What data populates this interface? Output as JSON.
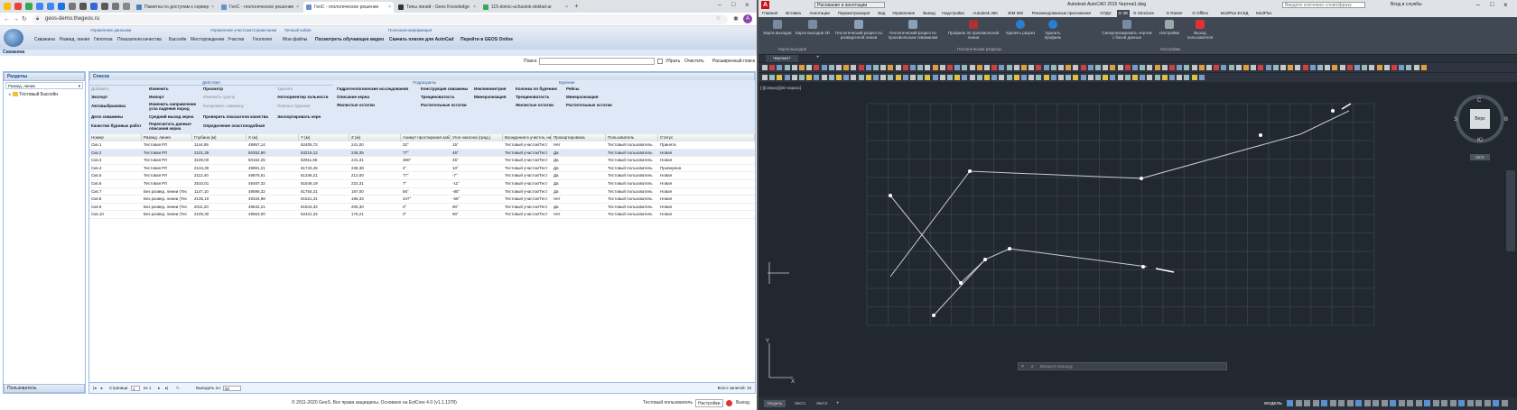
{
  "browser": {
    "tabs": [
      {
        "label": "Памятка по доступам к сервер"
      },
      {
        "label": "ГеоС - геологическое решение"
      },
      {
        "label": "ГеоС - геологическое решение"
      },
      {
        "label": "Типы линий - Geos Knowledge"
      },
      {
        "label": "115-doinic-uchastok-doklad-ar"
      }
    ],
    "url": "geos-demo.thegeos.ru"
  },
  "app": {
    "groups": [
      {
        "label": "Управление данными"
      },
      {
        "label": "Управление участком"
      },
      {
        "label": "Справочники"
      },
      {
        "label": "Личный кабин"
      },
      {
        "label": "Полезная информация"
      }
    ],
    "menu": [
      {
        "label": "Скважина"
      },
      {
        "label": "Развед. линия"
      },
      {
        "label": "Гипотеза"
      },
      {
        "label": "Показатели качества"
      },
      {
        "label": "Бассейн"
      },
      {
        "label": "Месторождение"
      },
      {
        "label": "Участки"
      },
      {
        "label": "Геология"
      },
      {
        "label": "Мои файлы"
      },
      {
        "label": "Посмотреть обучающее видео"
      },
      {
        "label": "Скачать плагин для AutoCad"
      },
      {
        "label": "Перейти в GEOS Online"
      }
    ],
    "section_title": "Скважина",
    "search": {
      "label": "Поиск:",
      "clear": "Убрать",
      "reset": "Очистить",
      "advanced": "Расширенный поиск"
    }
  },
  "sidebar": {
    "title": "Разделы",
    "filter": "Развед. линии",
    "tree_item": "Тестовый Бассейн",
    "bottom": "Пользователь"
  },
  "main": {
    "title": "Список",
    "action_groups": {
      "actions": "Действия",
      "subsections": "Подразделы",
      "drilling": "Бурение"
    },
    "actions": {
      "add": "Добавить",
      "edit": "Изменить",
      "view": "Просмотр",
      "delete": "Удалить",
      "export": "Экспорт",
      "import": "Импорт",
      "change_group": "Изменить группу",
      "autopoint": "Автоориентир зольности",
      "autocalc": "Автовыбраковка",
      "change_dir": "Изменить направление угла падения пород",
      "copy": "Копировать скважину",
      "transfer": "Перенос бурения",
      "drill_depth": "Дело скважины",
      "avg_out": "Средний выход керна",
      "check": "Проверить показатели качества",
      "export_core": "Экспортировать керн",
      "quality": "Качество буровых работ",
      "recalc": "Пересчитать данные описания керна",
      "define": "Определение эластоподобная"
    },
    "subsections": {
      "a": "Гидрогеологические исследования",
      "b": "Конструкция скважины",
      "c": "Инклинометрия",
      "d": "Описание керна",
      "e": "Трещиноватость",
      "f": "Минерализация",
      "g": "Жилистые остатки",
      "h": "Растительные остатки"
    },
    "drilling": {
      "a": "Колонка по бурению",
      "b": "Рейсы",
      "c": "Трещиноватость",
      "d": "Минерализация",
      "e": "Жилистые остатки",
      "f": "Растительные остатки"
    },
    "columns": [
      "Номер",
      "Развед. линия",
      "Глубина (м)",
      "X (м)",
      "Y (м)",
      "Z (м)",
      "Азимут простирания забоя",
      "Угол наклона (град.)",
      "Вхождения в участок, нас",
      "Прокартирована",
      "Пользователь",
      "Статус"
    ],
    "rows": [
      [
        "Скв.1",
        "Тестовая РЛ",
        "1144,95",
        "49957,14",
        "62405,72",
        "241,00",
        "32°",
        "15°",
        "Тестовый участок/Тест",
        "Нет",
        "Тестовый пользователь",
        "Принята"
      ],
      [
        "Скв.2",
        "Тестовая РЛ",
        "2101,35",
        "50262,90",
        "63216,12",
        "245,35",
        "77°",
        "45°",
        "Тестовый участок/Тест",
        "Да",
        "Тестовый пользователь",
        "Новая"
      ],
      [
        "Скв.3",
        "Тестовая РЛ",
        "3100,00",
        "50152,25",
        "62911,65",
        "241,31",
        "360°",
        "45°",
        "Тестовый участок/Тест",
        "Да",
        "Тестовый пользователь",
        "Новая"
      ],
      [
        "Скв.4",
        "Тестовая РЛ",
        "2134,30",
        "49991,21",
        "61743,45",
        "236,38",
        "2°",
        "10°",
        "Тестовый участок/Тест",
        "Да",
        "Тестовый пользователь",
        "Проверена"
      ],
      [
        "Скв.5",
        "Тестовая РЛ",
        "2112,40",
        "49876,51",
        "61346,21",
        "212,00",
        "77°",
        "-7°",
        "Тестовый участок/Тест",
        "Да",
        "Тестовый пользователь",
        "Новая"
      ],
      [
        "Скв.6",
        "Тестовая РЛ",
        "2510,01",
        "49487,32",
        "61646,19",
        "222,31",
        "7°",
        "-11°",
        "Тестовый участок/Тест",
        "Да",
        "Тестовый пользователь",
        "Новая"
      ],
      [
        "Скв.7",
        "Без развед. линии (Тес",
        "1147,10",
        "49596,32",
        "61754,21",
        "187,00",
        "56°",
        "-85°",
        "Тестовый участок/Тест",
        "Да",
        "Тестовый пользователь",
        "Новая"
      ],
      [
        "Скв.8",
        "Без развед. линии (Тес",
        "2135,10",
        "49334,98",
        "61521,31",
        "186,33",
        "247°",
        "-56°",
        "Тестовый участок/Тест",
        "Нет",
        "Тестовый пользователь",
        "Новая"
      ],
      [
        "Скв.9",
        "Без развед. линии (Тес",
        "2011,20",
        "49632,21",
        "61843,32",
        "205,30",
        "0°",
        "90°",
        "Тестовый участок/Тест",
        "Да",
        "Тестовый пользователь",
        "Новая"
      ],
      [
        "Скв.10",
        "Без развед. линии (Тес",
        "2105,30",
        "49563,00",
        "62421,32",
        "175,21",
        "0°",
        "90°",
        "Тестовый участок/Тест",
        "Нет",
        "Тестовый пользователь",
        "Новая"
      ]
    ],
    "pager": {
      "page_label": "Страница",
      "page": "1",
      "of": "из 1",
      "per_page_label": "Выводить по:",
      "per_page": "50",
      "total": "Всего записей: 10"
    }
  },
  "footer": {
    "copyright": "© 2011-2020 GeoS. Все права защищены. Основано на ExtCore 4.0 (v1.1.1378)",
    "user": "Тестовый пользователь",
    "settings": "Настройки",
    "logout": "Выход"
  },
  "acad": {
    "title": "Autodesk AutoCAD 2015   Чертеж1.dwg",
    "workspace": "Рисование и аннотации",
    "search_placeholder": "Введите ключевое слово/фразу",
    "login": "Вход в службы",
    "ribbon_tabs": [
      "Главная",
      "Вставка",
      "Аннотации",
      "Параметризация",
      "Вид",
      "Управление",
      "Вывод",
      "Надстройки",
      "Autodesk 360",
      "BIM 360",
      "Рекомендованные приложения",
      "СПДС",
      "G 3D",
      "G Structure",
      "G Raster",
      "G Offline",
      "ModPlus ЕСКД",
      "ModPlus"
    ],
    "ribbon_buttons": [
      {
        "label": "Карта выходов"
      },
      {
        "label": "Карта выходов 3D"
      },
      {
        "label": "Геологический разрез по разведочной линии"
      },
      {
        "label": "Геологический разрез по произвольным скважинам"
      },
      {
        "label": "Профиль по произвольной линии"
      },
      {
        "label": "Удалить разрез"
      },
      {
        "label": "Удалить профиль"
      },
      {
        "label": "Синхронизировать чертеж с базой данных"
      },
      {
        "label": "Настройки"
      },
      {
        "label": "Выход пользователя"
      }
    ],
    "ribbon_panels": [
      "Карта выходов",
      "Геологические разрезы",
      "Настройки"
    ],
    "doc_tab": "Чертеж1*",
    "view_label": "[-][Сверху][2D-каркас]",
    "viewcube": {
      "n": "С",
      "s": "Ю",
      "w": "З",
      "e": "В",
      "face": "Верх",
      "wcs": "МСК"
    },
    "command_placeholder": "Введите команду",
    "layout_tabs": [
      "Модель",
      "Лист1",
      "Лист2"
    ],
    "status_text": "МОДЕЛЬ",
    "accent": "#e03030"
  }
}
